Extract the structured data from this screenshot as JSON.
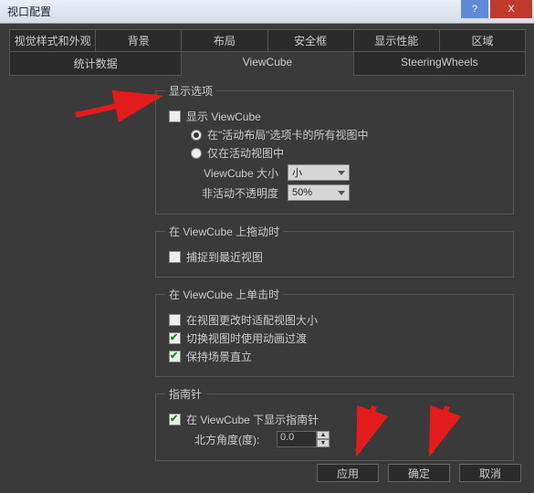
{
  "window": {
    "title": "视口配置"
  },
  "tabs1": [
    "视觉样式和外观",
    "背景",
    "布局",
    "安全框",
    "显示性能",
    "区域"
  ],
  "tabs2": [
    "统计数据",
    "ViewCube",
    "SteeringWheels"
  ],
  "tabs2_active_index": 1,
  "groups": {
    "display": {
      "legend": "显示选项",
      "show_vc": {
        "label": "显示 ViewCube",
        "checked": false
      },
      "radio_all": {
        "label": "在\"活动布局\"选项卡的所有视图中",
        "checked": true
      },
      "radio_active": {
        "label": "仅在活动视图中",
        "checked": false
      },
      "size_label": "ViewCube 大小",
      "size_value": "小",
      "opacity_label": "非活动不透明度",
      "opacity_value": "50%"
    },
    "drag": {
      "legend": "在 ViewCube 上拖动时",
      "snap": {
        "label": "捕捉到最近视图",
        "checked": false
      }
    },
    "click": {
      "legend": "在 ViewCube 上单击时",
      "fit": {
        "label": "在视图更改时适配视图大小",
        "checked": false
      },
      "anim": {
        "label": "切换视图时使用动画过渡",
        "checked": true
      },
      "up": {
        "label": "保持场景直立",
        "checked": true
      }
    },
    "compass": {
      "legend": "指南针",
      "show": {
        "label": "在 ViewCube 下显示指南针",
        "checked": true
      },
      "north_label": "北方角度(度):",
      "north_value": "0.0"
    }
  },
  "buttons": {
    "apply": "应用",
    "ok": "确定",
    "cancel": "取消"
  },
  "icons": {
    "help": "?",
    "close": "X"
  }
}
